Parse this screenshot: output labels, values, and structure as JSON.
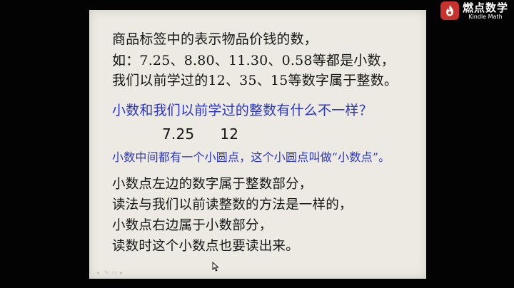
{
  "logo": {
    "name_cn": "燃点数学",
    "name_en": "Kindle Math"
  },
  "slide": {
    "lines": [
      "商品标签中的表示物品价钱的数，",
      "如：7.25、8.80、11.30、0.58等都是小数，",
      "我们以前学过的12、35、15等数字属于整数。",
      "小数和我们以前学过的整数有什么不一样？",
      "",
      "小数中间都有一个小圆点，这个小圆点叫做“小数点”。",
      "小数点左边的数字属于整数部分，",
      "读法与我们以前读整数的方法是一样的，",
      "小数点右边属于小数部分，",
      "读数时这个小数点也要读出来。"
    ],
    "example_decimal": "7.25",
    "example_integer": "12",
    "question_color": "#2a35c8",
    "text_color": "#161616"
  },
  "icons": {
    "cursor": "arrow-cursor-icon",
    "toolbar": [
      "arrow-icon",
      "pen-icon",
      "eraser-icon",
      "menu-icon"
    ]
  }
}
